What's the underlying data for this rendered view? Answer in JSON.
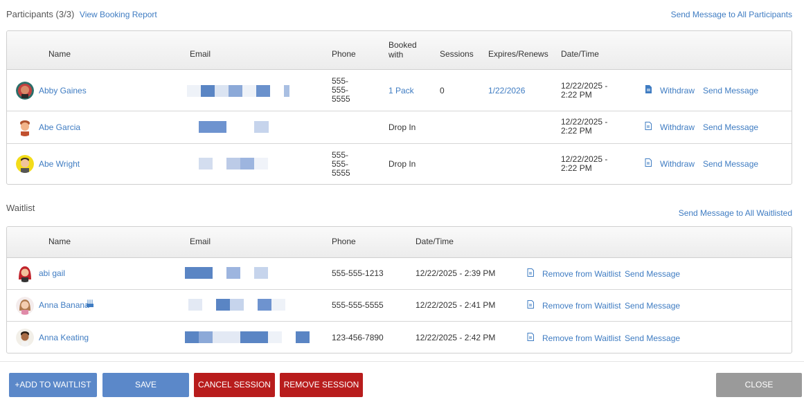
{
  "participants": {
    "title": "Participants",
    "count": "(3/3)",
    "report_link": "View Booking Report",
    "message_all": "Send Message to All Participants",
    "columns": {
      "name": "Name",
      "email": "Email",
      "phone": "Phone",
      "booked_with": "Booked with",
      "sessions": "Sessions",
      "expires": "Expires/Renews",
      "datetime": "Date/Time"
    },
    "rows": [
      {
        "name": "Abby Gaines",
        "phone": "555-\n555-\n5555",
        "booked_with": "1 Pack",
        "sessions": "0",
        "expires": "1/22/2026",
        "datetime": "12/22/2025 -\n2:22 PM",
        "withdraw": "Withdraw",
        "message": "Send Message"
      },
      {
        "name": "Abe Garcia",
        "phone": "",
        "booked_with": "Drop In",
        "sessions": "",
        "expires": "",
        "datetime": "12/22/2025 -\n2:22 PM",
        "withdraw": "Withdraw",
        "message": "Send Message"
      },
      {
        "name": "Abe Wright",
        "phone": "555-\n555-\n5555",
        "booked_with": "Drop In",
        "sessions": "",
        "expires": "",
        "datetime": "12/22/2025 -\n2:22 PM",
        "withdraw": "Withdraw",
        "message": "Send Message"
      }
    ]
  },
  "waitlist": {
    "title": "Waitlist",
    "message_all": "Send Message to All Waitlisted",
    "columns": {
      "name": "Name",
      "email": "Email",
      "phone": "Phone",
      "datetime": "Date/Time"
    },
    "rows": [
      {
        "name": "abi gail",
        "phone": "555-555-1213",
        "datetime": "12/22/2025 - 2:39 PM",
        "remove": "Remove from Waitlist",
        "message": "Send Message"
      },
      {
        "name": "Anna Banana",
        "phone": "555-555-5555",
        "datetime": "12/22/2025 - 2:41 PM",
        "remove": "Remove from Waitlist",
        "message": "Send Message",
        "badge_icon": "birthday-cake-icon"
      },
      {
        "name": "Anna Keating",
        "phone": "123-456-7890",
        "datetime": "12/22/2025 - 2:42 PM",
        "remove": "Remove from Waitlist",
        "message": "Send Message"
      }
    ]
  },
  "buttons": {
    "add_waitlist": "+ADD TO WAITLIST",
    "save": "SAVE",
    "cancel_session": "CANCEL SESSION",
    "remove_session": "REMOVE SESSION",
    "close": "CLOSE"
  },
  "colors": {
    "link": "#3f7cc2",
    "primary_button": "#5b88c9",
    "danger_button": "#b81c1c",
    "close_button": "#9a9a9a"
  }
}
